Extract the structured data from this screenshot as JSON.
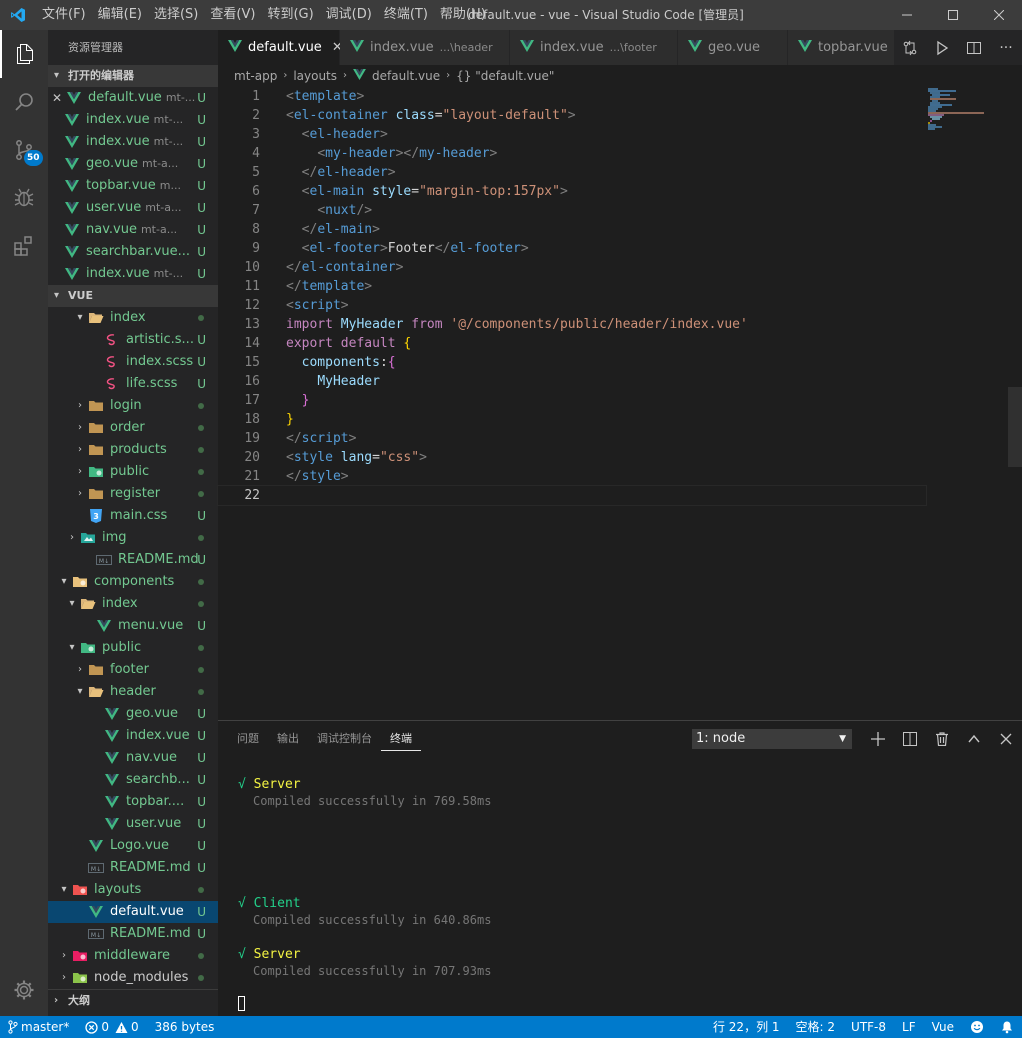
{
  "titlebar": {
    "menus": [
      "文件(F)",
      "编辑(E)",
      "选择(S)",
      "查看(V)",
      "转到(G)",
      "调试(D)",
      "终端(T)",
      "帮助(H)"
    ],
    "title": "default.vue - vue - Visual Studio Code [管理员]"
  },
  "activitybar": {
    "scm_badge": "50"
  },
  "sidebar": {
    "title": "资源管理器",
    "open_editors_header": "打开的编辑器",
    "open_editors": [
      {
        "name": "default.vue",
        "desc": "mt-...",
        "status": "U"
      },
      {
        "name": "index.vue",
        "desc": "mt-...",
        "status": "U"
      },
      {
        "name": "index.vue",
        "desc": "mt-...",
        "status": "U"
      },
      {
        "name": "geo.vue",
        "desc": "mt-a...",
        "status": "U"
      },
      {
        "name": "topbar.vue",
        "desc": "m...",
        "status": "U"
      },
      {
        "name": "user.vue",
        "desc": "mt-a...",
        "status": "U"
      },
      {
        "name": "nav.vue",
        "desc": "mt-a...",
        "status": "U"
      },
      {
        "name": "searchbar.vue...",
        "desc": "",
        "status": "U"
      },
      {
        "name": "index.vue",
        "desc": "mt-...",
        "status": "U"
      }
    ],
    "workspace_header": "VUE",
    "tree": [
      {
        "name": "index",
        "status": ""
      },
      {
        "name": "artistic.s...",
        "status": "U"
      },
      {
        "name": "index.scss",
        "status": "U"
      },
      {
        "name": "life.scss",
        "status": "U"
      },
      {
        "name": "login",
        "status": ""
      },
      {
        "name": "order",
        "status": ""
      },
      {
        "name": "products",
        "status": ""
      },
      {
        "name": "public",
        "status": ""
      },
      {
        "name": "register",
        "status": ""
      },
      {
        "name": "main.css",
        "status": "U"
      },
      {
        "name": "img",
        "status": ""
      },
      {
        "name": "README.md",
        "status": "U"
      },
      {
        "name": "components",
        "status": ""
      },
      {
        "name": "index",
        "status": ""
      },
      {
        "name": "menu.vue",
        "status": "U"
      },
      {
        "name": "public",
        "status": ""
      },
      {
        "name": "footer",
        "status": ""
      },
      {
        "name": "header",
        "status": ""
      },
      {
        "name": "geo.vue",
        "status": "U"
      },
      {
        "name": "index.vue",
        "status": "U"
      },
      {
        "name": "nav.vue",
        "status": "U"
      },
      {
        "name": "searchb...",
        "status": "U"
      },
      {
        "name": "topbar....",
        "status": "U"
      },
      {
        "name": "user.vue",
        "status": "U"
      },
      {
        "name": "Logo.vue",
        "status": "U"
      },
      {
        "name": "README.md",
        "status": "U"
      },
      {
        "name": "layouts",
        "status": ""
      },
      {
        "name": "default.vue",
        "status": "U"
      },
      {
        "name": "README.md",
        "status": "U"
      },
      {
        "name": "middleware",
        "status": ""
      },
      {
        "name": "node_modules",
        "status": ""
      }
    ],
    "outline_header": "大纲"
  },
  "tabs": [
    {
      "label": "default.vue",
      "desc": ""
    },
    {
      "label": "index.vue",
      "desc": "...\\header"
    },
    {
      "label": "index.vue",
      "desc": "...\\footer"
    },
    {
      "label": "geo.vue",
      "desc": ""
    },
    {
      "label": "topbar.vue",
      "desc": ""
    }
  ],
  "breadcrumb": {
    "root": "mt-app",
    "folder": "layouts",
    "file": "default.vue",
    "symbol": "{} \"default.vue\""
  },
  "code": {
    "line_numbers": [
      "1",
      "2",
      "3",
      "4",
      "5",
      "6",
      "7",
      "8",
      "9",
      "10",
      "11",
      "12",
      "13",
      "14",
      "15",
      "16",
      "17",
      "18",
      "19",
      "20",
      "21",
      "22"
    ],
    "l13_path": "'@/components/public/header/index.vue'",
    "l6_style": "\"margin-top:157px\"",
    "l2_class": "\"layout-default\"",
    "l20_lang": "\"css\""
  },
  "panel": {
    "tabs": [
      "问题",
      "输出",
      "调试控制台",
      "终端"
    ],
    "terminal_select": "1: node",
    "terminal": [
      {
        "mark": "√",
        "label": "Server",
        "msg": "Compiled successfully in 769.58ms"
      },
      {
        "mark": "√",
        "label": "Client",
        "msg": "Compiled successfully in 640.86ms"
      },
      {
        "mark": "√",
        "label": "Server",
        "msg": "Compiled successfully in 707.93ms"
      }
    ]
  },
  "statusbar": {
    "branch": "master*",
    "errors": "0",
    "warnings": "0",
    "size": "386 bytes",
    "position": "行 22，列 1",
    "spaces": "空格: 2",
    "encoding": "UTF-8",
    "eol": "LF",
    "language": "Vue"
  },
  "colors": {
    "accent": "#007acc",
    "untracked": "#73c991",
    "vue": "#41b883"
  }
}
